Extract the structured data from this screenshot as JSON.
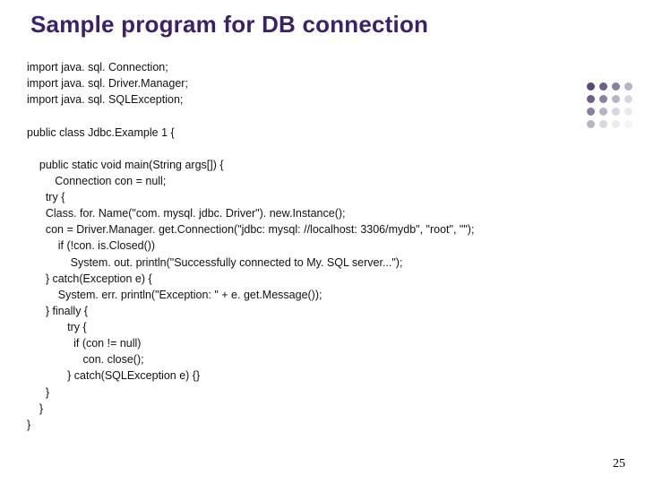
{
  "slide": {
    "title": "Sample program for DB connection",
    "page_number": "25"
  },
  "code": {
    "l01": "import java. sql. Connection;",
    "l02": "import java. sql. Driver.Manager;",
    "l03": "import java. sql. SQLException;",
    "l04": "",
    "l05": "public class Jdbc.Example 1 {",
    "l06": "",
    "l07": "    public static void main(String args[]) {",
    "l08": "         Connection con = null;",
    "l09": "      try {",
    "l10": "      Class. for. Name(\"com. mysql. jdbc. Driver\"). new.Instance();",
    "l11": "      con = Driver.Manager. get.Connection(\"jdbc: mysql: //localhost: 3306/mydb\", \"root\", \"\");",
    "l12": "          if (!con. is.Closed())",
    "l13": "              System. out. println(\"Successfully connected to My. SQL server...\");",
    "l14": "      } catch(Exception e) {",
    "l15": "          System. err. println(\"Exception: \" + e. get.Message());",
    "l16": "      } finally {",
    "l17": "             try {",
    "l18": "               if (con != null)",
    "l19": "                  con. close();",
    "l20": "             } catch(SQLException e) {}",
    "l21": "      }",
    "l22": "    }",
    "l23": "}"
  }
}
